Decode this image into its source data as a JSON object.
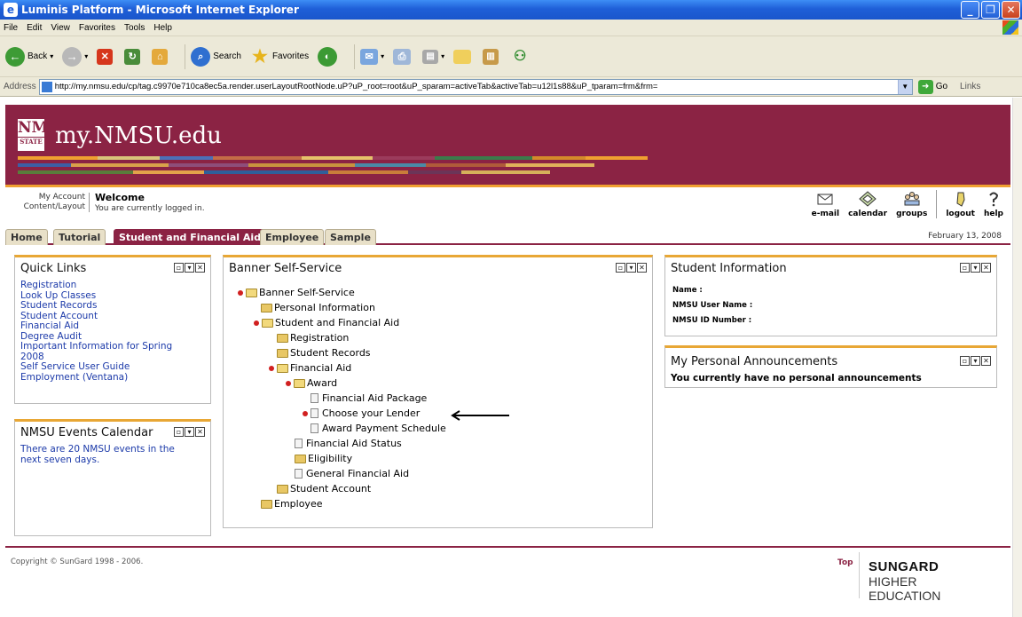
{
  "window": {
    "title": "Luminis Platform - Microsoft Internet Explorer",
    "menu": [
      "File",
      "Edit",
      "View",
      "Favorites",
      "Tools",
      "Help"
    ],
    "toolbar": {
      "back": "Back",
      "search": "Search",
      "favorites": "Favorites"
    },
    "address": {
      "label": "Address",
      "url": "http://my.nmsu.edu/cp/tag.c9970e710ca8ec5a.render.userLayoutRootNode.uP?uP_root=root&uP_sparam=activeTab&activeTab=u12l1s88&uP_tparam=frm&frm=",
      "go": "Go",
      "links": "Links"
    }
  },
  "portal": {
    "logo": {
      "nm": "NM",
      "state": "STATE"
    },
    "site_title": "my.NMSU.edu",
    "brand_color": "#8b2344",
    "accent_color": "#e8a735",
    "account": {
      "my_account": "My Account",
      "content_layout": "Content/Layout"
    },
    "welcome": {
      "title": "Welcome",
      "text": "You are currently logged in."
    },
    "utilities": [
      "e-mail",
      "calendar",
      "groups",
      "logout",
      "help"
    ],
    "tabs": [
      "Home",
      "Tutorial",
      "Student and Financial Aid",
      "Employee",
      "Sample"
    ],
    "active_tab": "Student and Financial Aid",
    "date": "February 13, 2008"
  },
  "quick_links": {
    "title": "Quick Links",
    "items": [
      "Registration",
      "Look Up Classes",
      "Student Records",
      "Student Account",
      "Financial Aid",
      "Degree Audit",
      "Important Information for Spring",
      "2008",
      "Self Service User Guide",
      "Employment (Ventana)"
    ]
  },
  "events": {
    "title": "NMSU Events Calendar",
    "text_line1": "There are 20 NMSU events in the",
    "text_line2": "next seven days."
  },
  "banner_ss": {
    "title": "Banner Self-Service",
    "tree": [
      "Banner Self-Service",
      "Personal Information",
      "Student and Financial Aid",
      "Registration",
      "Student Records",
      "Financial Aid",
      "Award",
      "Financial Aid Package",
      "Choose your Lender",
      "Award Payment Schedule",
      "Financial Aid Status",
      "Eligibility",
      "General Financial Aid",
      "Student Account",
      "Employee"
    ]
  },
  "student_info": {
    "title": "Student Information",
    "name_label": "Name :",
    "user_label": "NMSU User Name :",
    "id_label": "NMSU ID Number :"
  },
  "announcements": {
    "title": "My Personal Announcements",
    "text": "You currently have no personal announcements"
  },
  "footer": {
    "copyright": "Copyright © SunGard 1998 - 2006.",
    "top": "Top",
    "sungard": "SUNGARD",
    "higher_ed": "HIGHER EDUCATION"
  }
}
